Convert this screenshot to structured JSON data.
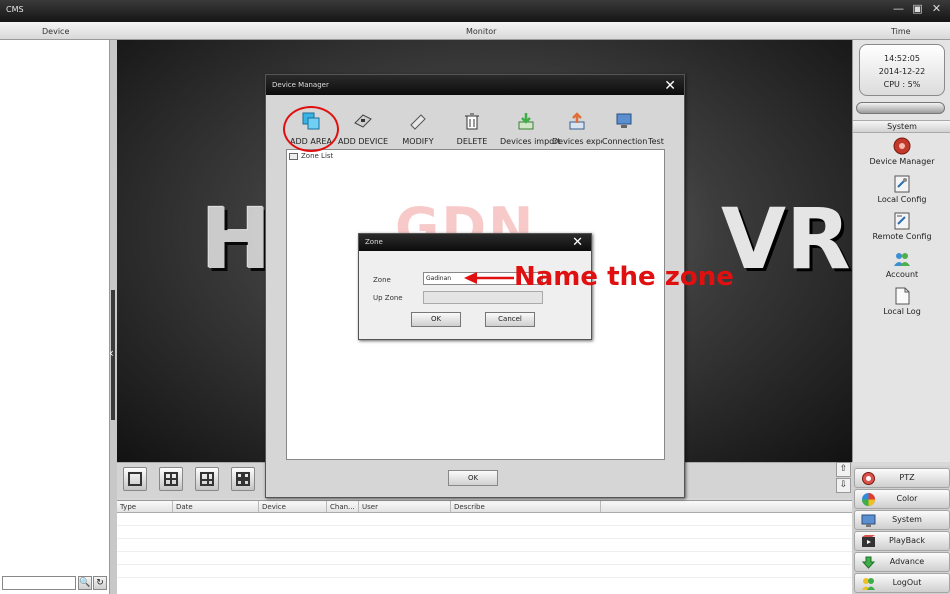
{
  "window": {
    "title": "CMS"
  },
  "header": {
    "device": "Device",
    "monitor": "Monitor",
    "time": "Time"
  },
  "status": {
    "time": "14:52:05",
    "date": "2014-12-22",
    "cpu": "CPU : 5%"
  },
  "system_panel": {
    "header": "System",
    "items": [
      {
        "label": "Device Manager",
        "icon": "device-manager-icon"
      },
      {
        "label": "Local Config",
        "icon": "local-config-icon"
      },
      {
        "label": "Remote Config",
        "icon": "remote-config-icon"
      },
      {
        "label": "Account",
        "icon": "account-icon"
      },
      {
        "label": "Local Log",
        "icon": "local-log-icon"
      }
    ]
  },
  "bottom_menu": [
    {
      "label": "PTZ",
      "icon": "ptz-icon"
    },
    {
      "label": "Color",
      "icon": "color-icon"
    },
    {
      "label": "System",
      "icon": "system-icon"
    },
    {
      "label": "PlayBack",
      "icon": "playback-icon"
    },
    {
      "label": "Advance",
      "icon": "advance-icon"
    },
    {
      "label": "LogOut",
      "icon": "logout-icon"
    }
  ],
  "log_table": {
    "columns": [
      "Type",
      "Date",
      "Device",
      "Chan...",
      "User",
      "Describe"
    ]
  },
  "monitor": {
    "logo_left": "H",
    "logo_right": "VR"
  },
  "device_manager": {
    "title": "Device Manager",
    "toolbar": [
      "ADD AREA",
      "ADD DEVICE",
      "MODIFY",
      "DELETE",
      "Devices import",
      "Devices expor",
      "Connection",
      "Test"
    ],
    "tree_root": "Zone List",
    "ok": "OK"
  },
  "watermark": "GDN",
  "zone_dialog": {
    "title": "Zone",
    "zone_label": "Zone",
    "zone_value": "Gadinan",
    "up_zone_label": "Up Zone",
    "ok": "OK",
    "cancel": "Cancel"
  },
  "annotation": "Name the zone"
}
